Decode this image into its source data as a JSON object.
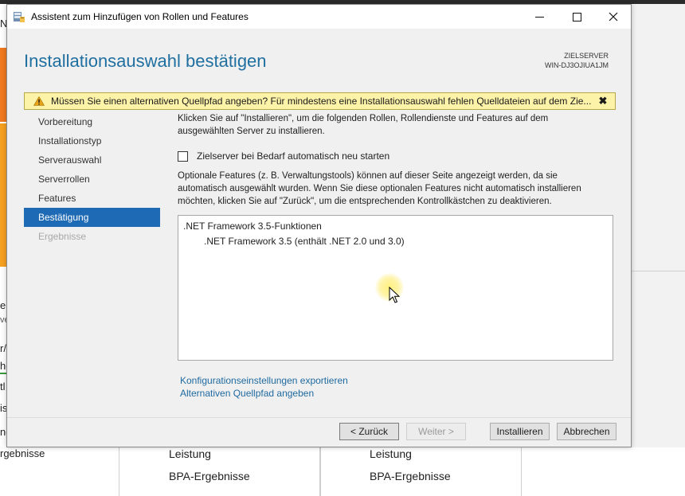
{
  "background": {
    "left_fragments": [
      "N",
      "er",
      "ve",
      "r/",
      "he",
      "tl",
      "is",
      "ng",
      "rgebnisse"
    ],
    "columns": [
      {
        "line1": "Leistung",
        "line2": "BPA-Ergebnisse"
      },
      {
        "line1": "Leistung",
        "line2": "BPA-Ergebnisse"
      }
    ]
  },
  "window": {
    "title": "Assistent zum Hinzufügen von Rollen und Features",
    "minimize_icon": "minimize-icon",
    "maximize_icon": "maximize-icon",
    "close_icon": "close-icon"
  },
  "header": {
    "page_title": "Installationsauswahl bestätigen",
    "target_label": "ZIELSERVER",
    "target_server": "WIN-DJ3OJIUA1JM"
  },
  "warning": {
    "text": "Müssen Sie einen alternativen Quellpfad angeben? Für mindestens eine Installationsauswahl fehlen Quelldateien auf dem Zie...",
    "close": "✖",
    "color": "#fdf3a8"
  },
  "nav": {
    "items": [
      {
        "label": "Vorbereitung",
        "state": "normal"
      },
      {
        "label": "Installationstyp",
        "state": "normal"
      },
      {
        "label": "Serverauswahl",
        "state": "normal"
      },
      {
        "label": "Serverrollen",
        "state": "normal"
      },
      {
        "label": "Features",
        "state": "normal"
      },
      {
        "label": "Bestätigung",
        "state": "active"
      },
      {
        "label": "Ergebnisse",
        "state": "disabled"
      }
    ],
    "active_color": "#1f6ab4"
  },
  "content": {
    "intro": "Klicken Sie auf \"Installieren\", um die folgenden Rollen, Rollendienste und Features auf dem ausgewählten Server zu installieren.",
    "restart_checkbox_label": "Zielserver bei Bedarf automatisch neu starten",
    "restart_checked": false,
    "optional_text": "Optionale Features (z. B. Verwaltungstools) können auf dieser Seite angezeigt werden, da sie automatisch ausgewählt wurden. Wenn Sie diese optionalen Features nicht automatisch installieren möchten, klicken Sie auf \"Zurück\", um die entsprechenden Kontrollkästchen zu deaktivieren.",
    "selection_items": [
      {
        "label": ".NET Framework 3.5-Funktionen",
        "level": 1
      },
      {
        "label": ".NET Framework 3.5 (enthält .NET 2.0 und 3.0)",
        "level": 2
      }
    ],
    "export_link": "Konfigurationseinstellungen exportieren",
    "alt_source_link": "Alternativen Quellpfad angeben"
  },
  "buttons": {
    "back": "< Zurück",
    "next": "Weiter >",
    "install": "Installieren",
    "cancel": "Abbrechen"
  }
}
